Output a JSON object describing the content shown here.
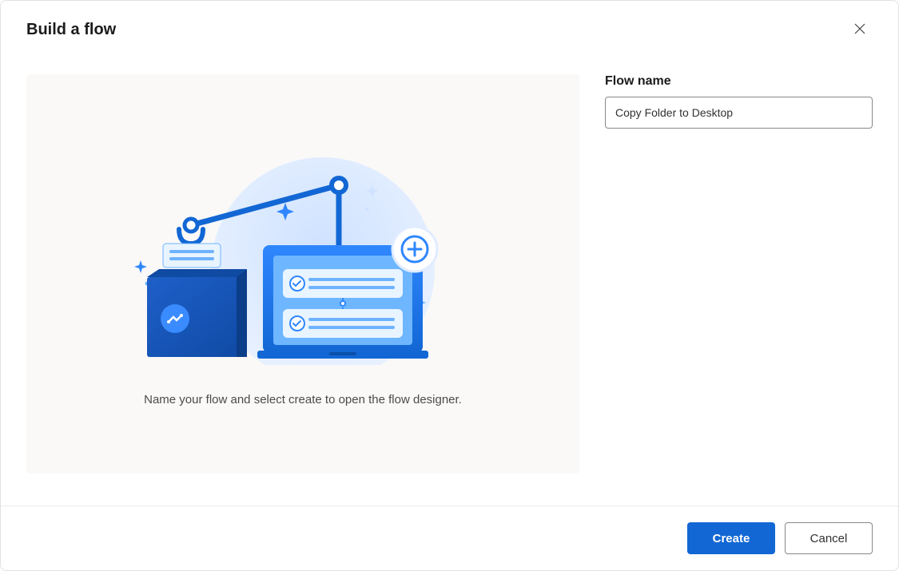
{
  "dialog": {
    "title": "Build a flow",
    "caption": "Name your flow and select create to open the flow designer."
  },
  "form": {
    "flow_name_label": "Flow name",
    "flow_name_value": "Copy Folder to Desktop"
  },
  "footer": {
    "create_label": "Create",
    "cancel_label": "Cancel"
  },
  "icons": {
    "close": "close-icon",
    "illustration": "flow-builder-illustration"
  },
  "colors": {
    "primary": "#1267d4",
    "accent_light": "#4a9eff",
    "panel_bg": "#faf9f8"
  }
}
